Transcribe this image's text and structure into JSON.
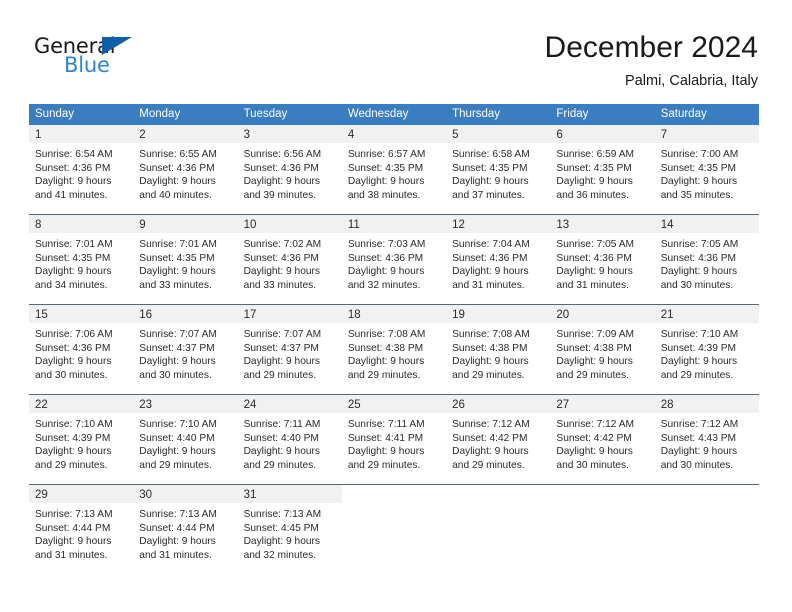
{
  "brand": {
    "name_primary": "General",
    "name_secondary": "Blue",
    "triangle_color": "#1060a8",
    "secondary_color": "#2a86d8"
  },
  "header": {
    "title": "December 2024",
    "subtitle": "Palmi, Calabria, Italy"
  },
  "theme": {
    "header_bar_color": "#3a7dc0",
    "day_band_color": "#f1f1f1",
    "row_divider_color": "#5a6672"
  },
  "weekdays": [
    "Sunday",
    "Monday",
    "Tuesday",
    "Wednesday",
    "Thursday",
    "Friday",
    "Saturday"
  ],
  "weeks": [
    [
      {
        "day": "1",
        "sunrise": "Sunrise: 6:54 AM",
        "sunset": "Sunset: 4:36 PM",
        "daylight_1": "Daylight: 9 hours",
        "daylight_2": "and 41 minutes."
      },
      {
        "day": "2",
        "sunrise": "Sunrise: 6:55 AM",
        "sunset": "Sunset: 4:36 PM",
        "daylight_1": "Daylight: 9 hours",
        "daylight_2": "and 40 minutes."
      },
      {
        "day": "3",
        "sunrise": "Sunrise: 6:56 AM",
        "sunset": "Sunset: 4:36 PM",
        "daylight_1": "Daylight: 9 hours",
        "daylight_2": "and 39 minutes."
      },
      {
        "day": "4",
        "sunrise": "Sunrise: 6:57 AM",
        "sunset": "Sunset: 4:35 PM",
        "daylight_1": "Daylight: 9 hours",
        "daylight_2": "and 38 minutes."
      },
      {
        "day": "5",
        "sunrise": "Sunrise: 6:58 AM",
        "sunset": "Sunset: 4:35 PM",
        "daylight_1": "Daylight: 9 hours",
        "daylight_2": "and 37 minutes."
      },
      {
        "day": "6",
        "sunrise": "Sunrise: 6:59 AM",
        "sunset": "Sunset: 4:35 PM",
        "daylight_1": "Daylight: 9 hours",
        "daylight_2": "and 36 minutes."
      },
      {
        "day": "7",
        "sunrise": "Sunrise: 7:00 AM",
        "sunset": "Sunset: 4:35 PM",
        "daylight_1": "Daylight: 9 hours",
        "daylight_2": "and 35 minutes."
      }
    ],
    [
      {
        "day": "8",
        "sunrise": "Sunrise: 7:01 AM",
        "sunset": "Sunset: 4:35 PM",
        "daylight_1": "Daylight: 9 hours",
        "daylight_2": "and 34 minutes."
      },
      {
        "day": "9",
        "sunrise": "Sunrise: 7:01 AM",
        "sunset": "Sunset: 4:35 PM",
        "daylight_1": "Daylight: 9 hours",
        "daylight_2": "and 33 minutes."
      },
      {
        "day": "10",
        "sunrise": "Sunrise: 7:02 AM",
        "sunset": "Sunset: 4:36 PM",
        "daylight_1": "Daylight: 9 hours",
        "daylight_2": "and 33 minutes."
      },
      {
        "day": "11",
        "sunrise": "Sunrise: 7:03 AM",
        "sunset": "Sunset: 4:36 PM",
        "daylight_1": "Daylight: 9 hours",
        "daylight_2": "and 32 minutes."
      },
      {
        "day": "12",
        "sunrise": "Sunrise: 7:04 AM",
        "sunset": "Sunset: 4:36 PM",
        "daylight_1": "Daylight: 9 hours",
        "daylight_2": "and 31 minutes."
      },
      {
        "day": "13",
        "sunrise": "Sunrise: 7:05 AM",
        "sunset": "Sunset: 4:36 PM",
        "daylight_1": "Daylight: 9 hours",
        "daylight_2": "and 31 minutes."
      },
      {
        "day": "14",
        "sunrise": "Sunrise: 7:05 AM",
        "sunset": "Sunset: 4:36 PM",
        "daylight_1": "Daylight: 9 hours",
        "daylight_2": "and 30 minutes."
      }
    ],
    [
      {
        "day": "15",
        "sunrise": "Sunrise: 7:06 AM",
        "sunset": "Sunset: 4:36 PM",
        "daylight_1": "Daylight: 9 hours",
        "daylight_2": "and 30 minutes."
      },
      {
        "day": "16",
        "sunrise": "Sunrise: 7:07 AM",
        "sunset": "Sunset: 4:37 PM",
        "daylight_1": "Daylight: 9 hours",
        "daylight_2": "and 30 minutes."
      },
      {
        "day": "17",
        "sunrise": "Sunrise: 7:07 AM",
        "sunset": "Sunset: 4:37 PM",
        "daylight_1": "Daylight: 9 hours",
        "daylight_2": "and 29 minutes."
      },
      {
        "day": "18",
        "sunrise": "Sunrise: 7:08 AM",
        "sunset": "Sunset: 4:38 PM",
        "daylight_1": "Daylight: 9 hours",
        "daylight_2": "and 29 minutes."
      },
      {
        "day": "19",
        "sunrise": "Sunrise: 7:08 AM",
        "sunset": "Sunset: 4:38 PM",
        "daylight_1": "Daylight: 9 hours",
        "daylight_2": "and 29 minutes."
      },
      {
        "day": "20",
        "sunrise": "Sunrise: 7:09 AM",
        "sunset": "Sunset: 4:38 PM",
        "daylight_1": "Daylight: 9 hours",
        "daylight_2": "and 29 minutes."
      },
      {
        "day": "21",
        "sunrise": "Sunrise: 7:10 AM",
        "sunset": "Sunset: 4:39 PM",
        "daylight_1": "Daylight: 9 hours",
        "daylight_2": "and 29 minutes."
      }
    ],
    [
      {
        "day": "22",
        "sunrise": "Sunrise: 7:10 AM",
        "sunset": "Sunset: 4:39 PM",
        "daylight_1": "Daylight: 9 hours",
        "daylight_2": "and 29 minutes."
      },
      {
        "day": "23",
        "sunrise": "Sunrise: 7:10 AM",
        "sunset": "Sunset: 4:40 PM",
        "daylight_1": "Daylight: 9 hours",
        "daylight_2": "and 29 minutes."
      },
      {
        "day": "24",
        "sunrise": "Sunrise: 7:11 AM",
        "sunset": "Sunset: 4:40 PM",
        "daylight_1": "Daylight: 9 hours",
        "daylight_2": "and 29 minutes."
      },
      {
        "day": "25",
        "sunrise": "Sunrise: 7:11 AM",
        "sunset": "Sunset: 4:41 PM",
        "daylight_1": "Daylight: 9 hours",
        "daylight_2": "and 29 minutes."
      },
      {
        "day": "26",
        "sunrise": "Sunrise: 7:12 AM",
        "sunset": "Sunset: 4:42 PM",
        "daylight_1": "Daylight: 9 hours",
        "daylight_2": "and 29 minutes."
      },
      {
        "day": "27",
        "sunrise": "Sunrise: 7:12 AM",
        "sunset": "Sunset: 4:42 PM",
        "daylight_1": "Daylight: 9 hours",
        "daylight_2": "and 30 minutes."
      },
      {
        "day": "28",
        "sunrise": "Sunrise: 7:12 AM",
        "sunset": "Sunset: 4:43 PM",
        "daylight_1": "Daylight: 9 hours",
        "daylight_2": "and 30 minutes."
      }
    ],
    [
      {
        "day": "29",
        "sunrise": "Sunrise: 7:13 AM",
        "sunset": "Sunset: 4:44 PM",
        "daylight_1": "Daylight: 9 hours",
        "daylight_2": "and 31 minutes."
      },
      {
        "day": "30",
        "sunrise": "Sunrise: 7:13 AM",
        "sunset": "Sunset: 4:44 PM",
        "daylight_1": "Daylight: 9 hours",
        "daylight_2": "and 31 minutes."
      },
      {
        "day": "31",
        "sunrise": "Sunrise: 7:13 AM",
        "sunset": "Sunset: 4:45 PM",
        "daylight_1": "Daylight: 9 hours",
        "daylight_2": "and 32 minutes."
      },
      {
        "day": "",
        "sunrise": "",
        "sunset": "",
        "daylight_1": "",
        "daylight_2": ""
      },
      {
        "day": "",
        "sunrise": "",
        "sunset": "",
        "daylight_1": "",
        "daylight_2": ""
      },
      {
        "day": "",
        "sunrise": "",
        "sunset": "",
        "daylight_1": "",
        "daylight_2": ""
      },
      {
        "day": "",
        "sunrise": "",
        "sunset": "",
        "daylight_1": "",
        "daylight_2": ""
      }
    ]
  ]
}
